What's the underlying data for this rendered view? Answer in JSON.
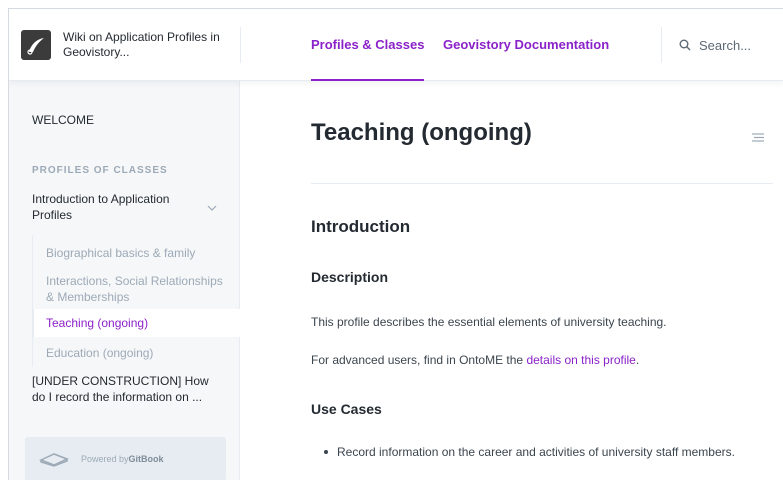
{
  "header": {
    "site_title": "Wiki on Application Profiles in Geovistory...",
    "nav": [
      {
        "label": "Profiles & Classes",
        "active": true
      },
      {
        "label": "Geovistory Documentation",
        "active": false
      }
    ],
    "search_placeholder": "Search...",
    "accent_color": "#8b21c9"
  },
  "sidebar": {
    "welcome": "WELCOME",
    "section_title": "PROFILES OF CLASSES",
    "intro_item": "Introduction to Application Profiles",
    "sub_items": [
      {
        "label": "Biographical basics & family",
        "active": false
      },
      {
        "label": "Interactions, Social Relationships & Memberships",
        "active": false
      },
      {
        "label": "Teaching (ongoing)",
        "active": true
      },
      {
        "label": "Education (ongoing)",
        "active": false
      }
    ],
    "under_construction": "[UNDER CONSTRUCTION] How do I record the information on ...",
    "powered_prefix": "Powered by ",
    "powered_brand": "GitBook"
  },
  "content": {
    "page_title": "Teaching (ongoing)",
    "h_introduction": "Introduction",
    "h_description": "Description",
    "description_text": "This profile describes the essential elements of university teaching.",
    "advanced_prefix": "For advanced users, find in OntoME the ",
    "advanced_link": "details on this profile",
    "advanced_suffix": ".",
    "h_use_cases": "Use Cases",
    "use_cases": [
      "Record information on the career and activities of university staff members."
    ]
  }
}
